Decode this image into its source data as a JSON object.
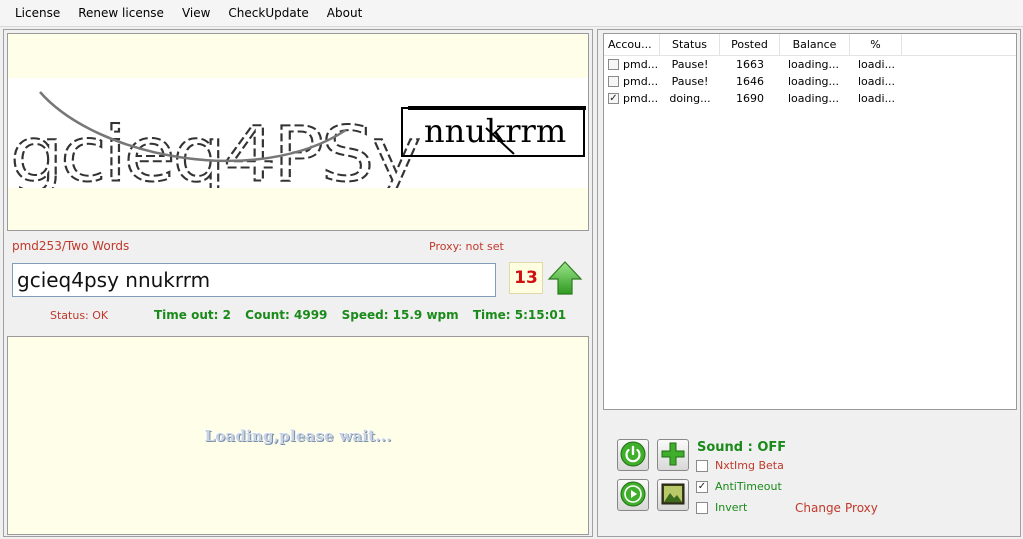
{
  "menu": [
    "License",
    "Renew license",
    "View",
    "CheckUpdate",
    "About"
  ],
  "captcha": {
    "word1": "gcieq4PSy",
    "word2": "nnukrrm"
  },
  "account_label": "pmd253/Two Words",
  "proxy_label": "Proxy: not set",
  "answer_value": "gcieq4psy nnukrrm",
  "counter": "13",
  "status_text": "Status: OK",
  "stats": {
    "timeout": "Time out: 2",
    "count": "Count: 4999",
    "speed": "Speed: 15.9 wpm",
    "time": "Time: 5:15:01"
  },
  "loading_text": "Loading,please wait...",
  "table": {
    "headers": [
      "Accou...",
      "Status",
      "Posted",
      "Balance",
      "%"
    ],
    "rows": [
      {
        "checked": false,
        "account": "pmd...",
        "status": "Pause!",
        "posted": "1663",
        "balance": "loading...",
        "percent": "loadi..."
      },
      {
        "checked": false,
        "account": "pmd...",
        "status": "Pause!",
        "posted": "1646",
        "balance": "loading...",
        "percent": "loadi..."
      },
      {
        "checked": true,
        "account": "pmd...",
        "status": "doing...",
        "posted": "1690",
        "balance": "loading...",
        "percent": "loadi..."
      }
    ]
  },
  "controls": {
    "sound_label": "Sound : OFF",
    "nxtimg_label": "NxtImg Beta",
    "nxtimg_checked": false,
    "antitimeout_label": "AntiTimeout",
    "antitimeout_checked": true,
    "invert_label": "Invert",
    "invert_checked": false,
    "change_link": "Change",
    "proxy_link": "Proxy"
  },
  "colors": {
    "red_text": "#c0392b",
    "green_text": "#1a8a1a",
    "panel_bg": "#fffee8"
  }
}
